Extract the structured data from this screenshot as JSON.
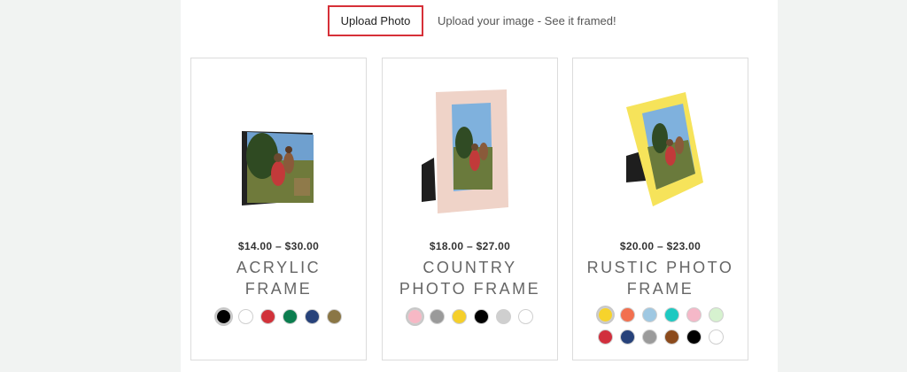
{
  "upload": {
    "button_label": "Upload Photo",
    "hint": "Upload your image - See it framed!"
  },
  "products": [
    {
      "price": "$14.00 – $30.00",
      "title_line1": "ACRYLIC",
      "title_line2": "FRAME",
      "frame_icon": "acrylic-block-icon",
      "swatches": [
        "#000000",
        "#ffffff",
        "#d1323a",
        "#0b7d4e",
        "#27427a",
        "#8a7645"
      ]
    },
    {
      "price": "$18.00 – $27.00",
      "title_line1": "COUNTRY",
      "title_line2": "PHOTO FRAME",
      "frame_icon": "pink-frame-icon",
      "swatches": [
        "#f7b8c5",
        "#9a9a9a",
        "#f5cf2b",
        "#000000",
        "#cfcfcf",
        "#ffffff"
      ]
    },
    {
      "price": "$20.00 – $23.00",
      "title_line1": "RUSTIC PHOTO",
      "title_line2": "FRAME",
      "frame_icon": "yellow-frame-icon",
      "swatches": [
        "#f6d32c",
        "#f2704f",
        "#9fc8e2",
        "#1ec9c1",
        "#f5b8c8",
        "#d6f2cf",
        "#d12f3d",
        "#27427a",
        "#9b9b9b",
        "#8b4a1c",
        "#000000",
        "#ffffff"
      ]
    }
  ]
}
